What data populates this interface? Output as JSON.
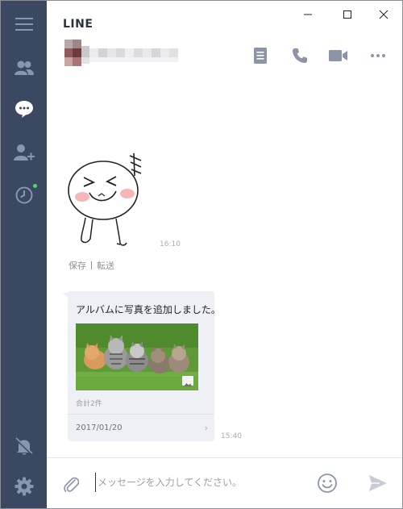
{
  "app": {
    "title": "LINE"
  },
  "window": {
    "minimize": "minimize",
    "maximize": "maximize",
    "close": "close"
  },
  "sidebar": {
    "items": [
      {
        "name": "menu",
        "icon": "hamburger-icon"
      },
      {
        "name": "friends",
        "icon": "friends-icon"
      },
      {
        "name": "chats",
        "icon": "chat-bubble-icon",
        "active": true
      },
      {
        "name": "add-friend",
        "icon": "add-friend-icon"
      },
      {
        "name": "timeline",
        "icon": "clock-icon"
      },
      {
        "name": "notifications",
        "icon": "bell-off-icon"
      },
      {
        "name": "settings",
        "icon": "gear-icon"
      }
    ],
    "timeline_has_new": true
  },
  "chat_header": {
    "contact_name_censored": true,
    "icons": [
      "note-icon",
      "phone-icon",
      "video-icon",
      "more-icon"
    ]
  },
  "messages": [
    {
      "type": "sticker",
      "sticker": "laughing-face-sticker",
      "time": "16:10",
      "actions": [
        "保存",
        "転送"
      ]
    },
    {
      "type": "album",
      "title": "アルバムに写真を追加しました。",
      "photo": "kittens-on-grass",
      "count": "合計2件",
      "date": "2017/01/20",
      "time": "15:40"
    }
  ],
  "input": {
    "placeholder": "メッセージを入力してください。",
    "value": ""
  },
  "colors": {
    "sidebar": "#3b4861",
    "sidebar_icon": "#8a96ad",
    "sidebar_active": "#ffffff",
    "header_icon": "#8b95a7",
    "album_bg": "#eef0f5",
    "online": "#4cd964"
  }
}
